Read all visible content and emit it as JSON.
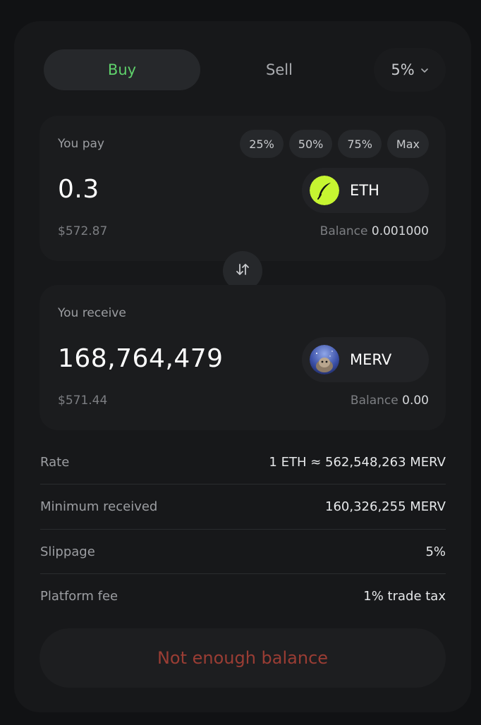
{
  "tabs": {
    "buy_label": "Buy",
    "sell_label": "Sell",
    "active": "Buy"
  },
  "slippage_select": {
    "value": "5%",
    "icon": "chevron-down-icon"
  },
  "pay": {
    "label": "You pay",
    "amount": "0.3",
    "usd_value": "$572.87",
    "percent_buttons": [
      "25%",
      "50%",
      "75%",
      "Max"
    ],
    "token": {
      "symbol": "ETH",
      "icon": "eth-feather-icon",
      "icon_color": "#c6f531"
    },
    "balance_label": "Balance",
    "balance_value": "0.001000"
  },
  "swap": {
    "icon": "swap-arrows-icon"
  },
  "receive": {
    "label": "You receive",
    "amount": "168,764,479",
    "usd_value": "$571.44",
    "token": {
      "symbol": "MERV",
      "icon": "merv-token-icon"
    },
    "balance_label": "Balance",
    "balance_value": "0.00"
  },
  "details": [
    {
      "label": "Rate",
      "value": "1 ETH ≈ 562,548,263 MERV"
    },
    {
      "label": "Minimum received",
      "value": "160,326,255 MERV"
    },
    {
      "label": "Slippage",
      "value": "5%"
    },
    {
      "label": "Platform fee",
      "value": "1% trade tax"
    }
  ],
  "cta": {
    "label": "Not enough balance",
    "color": "#9a3d34"
  },
  "colors": {
    "accent_green": "#5fd16b",
    "background": "#111214",
    "card": "#17181a"
  }
}
